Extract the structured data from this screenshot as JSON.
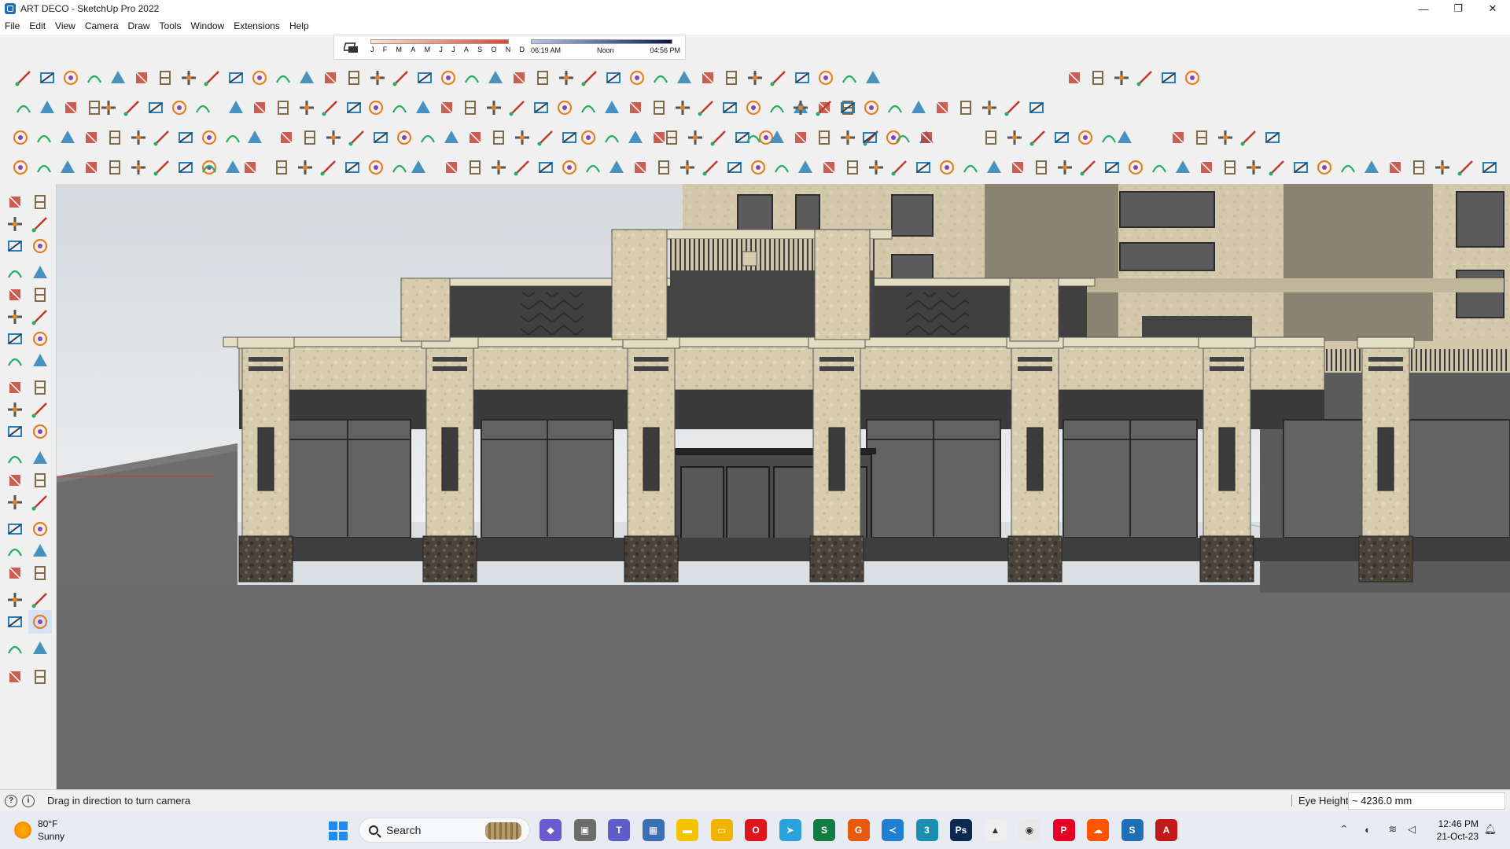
{
  "window": {
    "title": "ART DECO - SketchUp Pro 2022",
    "controls": {
      "minimize": "—",
      "maximize": "❐",
      "close": "✕"
    }
  },
  "menu": [
    "File",
    "Edit",
    "View",
    "Camera",
    "Draw",
    "Tools",
    "Window",
    "Extensions",
    "Help"
  ],
  "shadows": {
    "months": [
      "J",
      "F",
      "M",
      "A",
      "M",
      "J",
      "J",
      "A",
      "S",
      "O",
      "N",
      "D"
    ],
    "time_start": "06:19 AM",
    "time_mid": "Noon",
    "time_end": "04:56 PM"
  },
  "status": {
    "hint": "Drag in direction to turn camera",
    "vcb_label": "Eye Height",
    "vcb_value": "~ 4236.0 mm"
  },
  "taskbar": {
    "weather_temp": "80°F",
    "weather_desc": "Sunny",
    "search_label": "Search",
    "time": "12:46 PM",
    "date": "21-Oct-23",
    "apps": [
      {
        "name": "copilot-icon",
        "color": "#6a5acd",
        "glyph": "◆"
      },
      {
        "name": "task-view-icon",
        "color": "#6b6b6b",
        "glyph": "▣"
      },
      {
        "name": "teams-icon",
        "color": "#5b5fc7",
        "glyph": "T"
      },
      {
        "name": "calculator-icon",
        "color": "#3d6fb5",
        "glyph": "▦"
      },
      {
        "name": "sticky-notes-icon",
        "color": "#f5c400",
        "glyph": "▬"
      },
      {
        "name": "file-explorer-icon",
        "color": "#f0b400",
        "glyph": "▭"
      },
      {
        "name": "opera-icon",
        "color": "#e0141e",
        "glyph": "O"
      },
      {
        "name": "telegram-icon",
        "color": "#2aa3dc",
        "glyph": "➤"
      },
      {
        "name": "excel-icon",
        "color": "#107c41",
        "glyph": "S"
      },
      {
        "name": "g-app-icon",
        "color": "#e8590c",
        "glyph": "G"
      },
      {
        "name": "vscode-icon",
        "color": "#1f7fd1",
        "glyph": "≺"
      },
      {
        "name": "three-app-icon",
        "color": "#1b8fb0",
        "glyph": "3"
      },
      {
        "name": "photoshop-icon",
        "color": "#0a2b4f",
        "glyph": "Ps"
      },
      {
        "name": "google-drive-icon",
        "color": "#eeeeee",
        "glyph": "▲"
      },
      {
        "name": "chrome-icon",
        "color": "#e8e8e8",
        "glyph": "◉"
      },
      {
        "name": "pinterest-icon",
        "color": "#e60023",
        "glyph": "P"
      },
      {
        "name": "soundcloud-icon",
        "color": "#ff5500",
        "glyph": "☁"
      },
      {
        "name": "sketchup-icon",
        "color": "#1f6fb6",
        "glyph": "S"
      },
      {
        "name": "autocad-icon",
        "color": "#c21a1a",
        "glyph": "A"
      }
    ]
  },
  "colors": {
    "sky_top": "#d6dade",
    "sky_bottom": "#eef0f1",
    "ground": "#6e6e6e",
    "stone": "#d7ccb0",
    "stone_dark": "#b8ab8d",
    "glass": "#575757",
    "base_dark": "#4c463d"
  }
}
